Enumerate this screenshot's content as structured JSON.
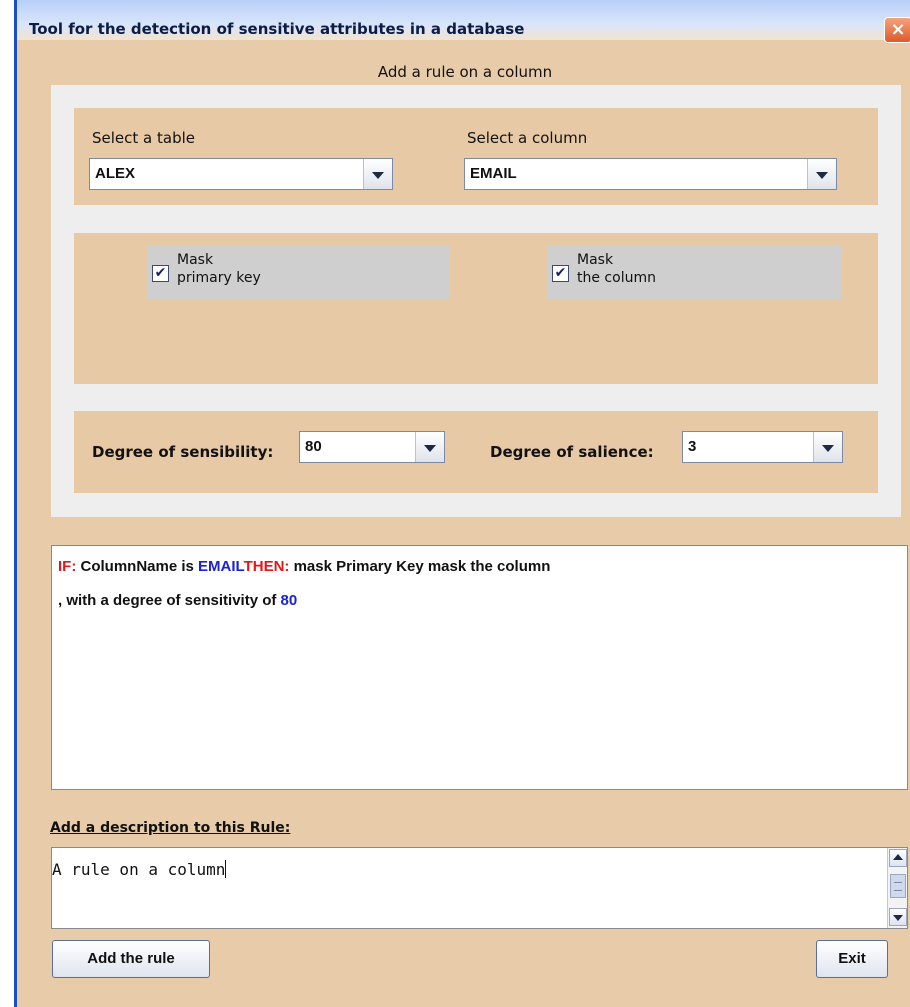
{
  "window": {
    "title": "Tool for the detection of sensitive attributes in a database",
    "close_glyph": "×",
    "subtitle": "Add a rule on a column"
  },
  "selectors": {
    "table_label": "Select a table",
    "table_value": "ALEX",
    "column_label": "Select a column",
    "column_value": "EMAIL"
  },
  "options": {
    "mask_primary_key": {
      "checked": true,
      "line1": "Mask",
      "line2": "primary key"
    },
    "mask_column": {
      "checked": true,
      "line1": "Mask",
      "line2": "the column"
    },
    "check_glyph": "✔"
  },
  "degrees": {
    "sensibility_label": "Degree of sensibility:",
    "sensibility_value": "80",
    "salience_label": "Degree of salience:",
    "salience_value": "3"
  },
  "rule": {
    "if_keyword": "IF:",
    "condition_text": " ColumnName is ",
    "column_name": "EMAIL",
    "then_keyword": "THEN:",
    "action_text": " mask Primary Key mask the column",
    "line2_text": ", with a degree of sensitivity of ",
    "sensitivity_value": "80"
  },
  "description": {
    "label": "Add a description to this Rule:",
    "value": "A rule on a column"
  },
  "buttons": {
    "add_rule": "Add the rule",
    "exit": "Exit"
  },
  "colors": {
    "panel": "#e8c9a5",
    "window_bg": "#e8ccaa",
    "keyword_red": "#e01818",
    "value_blue": "#1a22d6"
  }
}
